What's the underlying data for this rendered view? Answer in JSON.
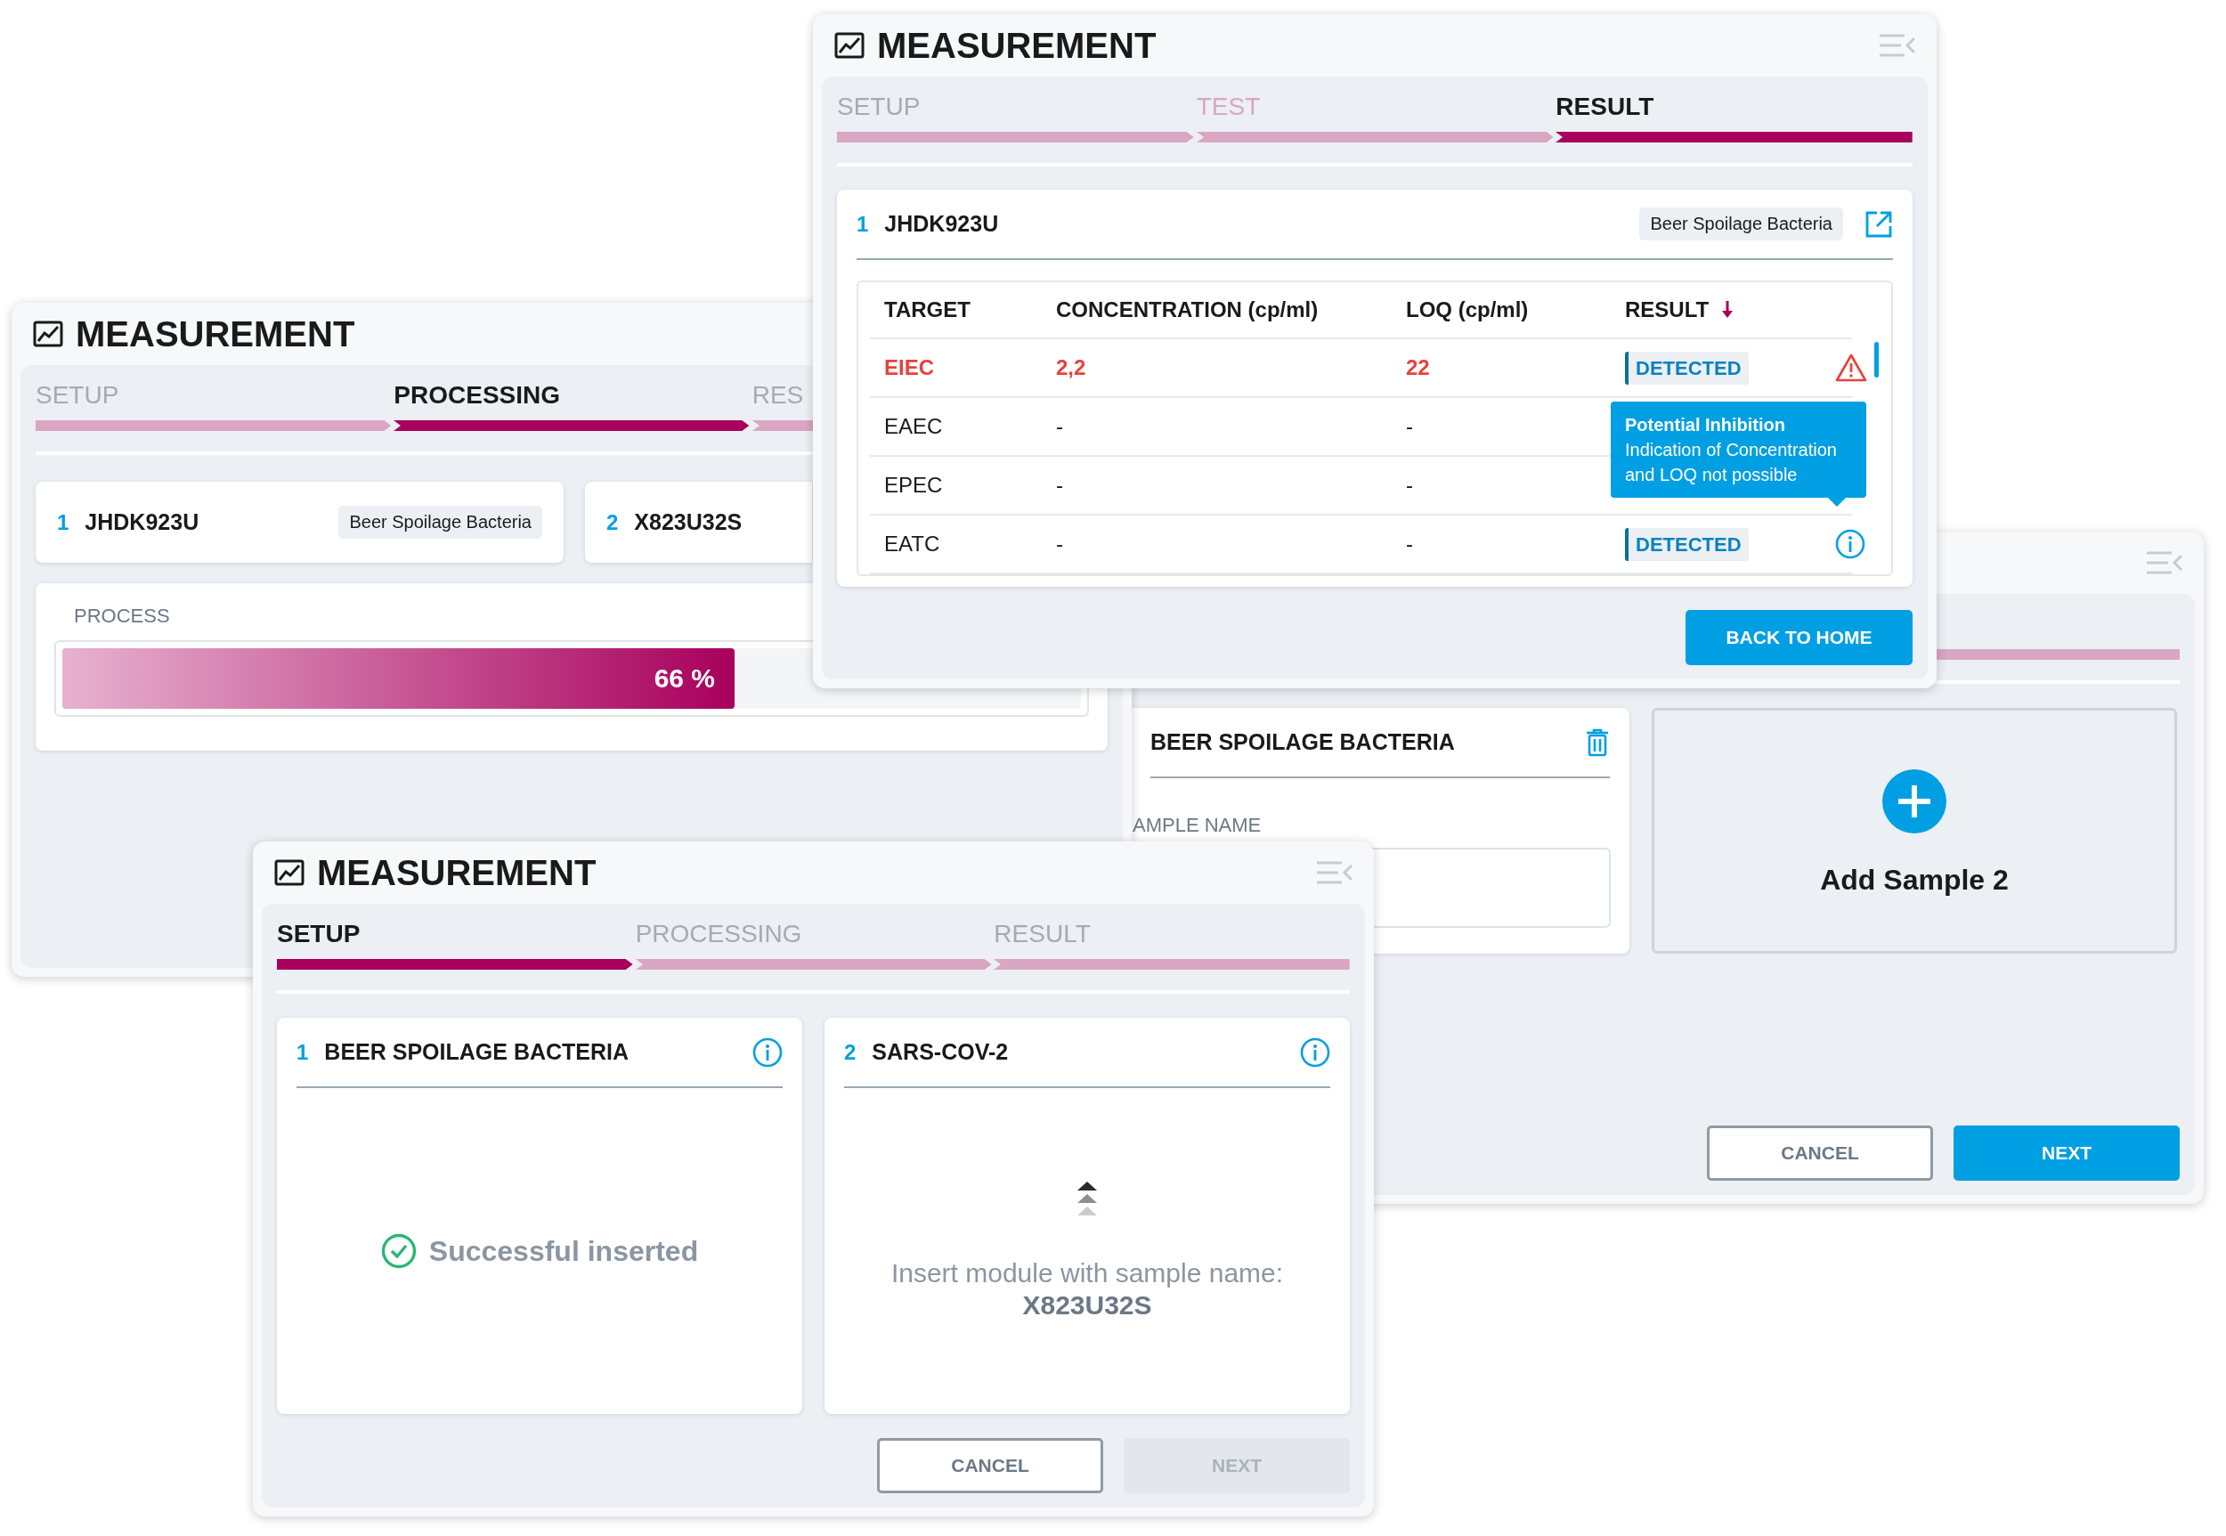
{
  "processing_window": {
    "title": "MEASUREMENT",
    "steps": [
      {
        "label": "SETUP",
        "selected": false,
        "tinted": false
      },
      {
        "label": "PROCESSING",
        "selected": true,
        "tinted": false
      },
      {
        "label": "RES",
        "selected": false,
        "tinted": false
      }
    ],
    "samples": [
      {
        "number": "1",
        "name": "JHDK923U",
        "tag": "Beer Spoilage Bacteria"
      },
      {
        "number": "2",
        "name": "X823U32S"
      }
    ],
    "process": {
      "label": "PROCESS",
      "level": 0.66,
      "reading": "66 %"
    }
  },
  "setup_window_back": {
    "sample_card": {
      "title": "BEER SPOILAGE BACTERIA",
      "field_label": "AMPLE NAME"
    },
    "add_card": {
      "label": "Add Sample 2"
    },
    "buttons": [
      {
        "label": "CANCEL",
        "kind": "secondary"
      },
      {
        "label": "NEXT",
        "kind": "primary",
        "disabled": false
      }
    ]
  },
  "result_window": {
    "title": "MEASUREMENT",
    "steps": [
      {
        "label": "SETUP",
        "selected": false,
        "tinted": false
      },
      {
        "label": "TEST",
        "selected": false,
        "tinted": true
      },
      {
        "label": "RESULT",
        "selected": true,
        "tinted": false
      }
    ],
    "sample": {
      "number": "1",
      "name": "JHDK923U",
      "tag": "Beer Spoilage Bacteria"
    },
    "table": {
      "columns": [
        {
          "label": "TARGET",
          "sorted": false
        },
        {
          "label": "CONCENTRATION (cp/ml)",
          "sorted": false
        },
        {
          "label": "LOQ (cp/ml)",
          "sorted": false
        },
        {
          "label": "RESULT",
          "sorted": true
        }
      ],
      "rows": [
        {
          "target": "EIEC",
          "concentration": "2,2",
          "loq": "22",
          "result": "DETECTED",
          "alert": true,
          "kind": "warning"
        },
        {
          "target": "EAEC",
          "concentration": "-",
          "loq": "-",
          "alert": false,
          "kind": "plain"
        },
        {
          "target": "EPEC",
          "concentration": "-",
          "loq": "-",
          "alert": false,
          "kind": "plain"
        },
        {
          "target": "EATC",
          "concentration": "-",
          "loq": "-",
          "result": "DETECTED",
          "alert": false,
          "kind": "info"
        }
      ]
    },
    "tooltip": {
      "title": "Potential Inhibition",
      "text": "Indication of Concentration and LOQ not possible"
    },
    "button": "BACK TO HOME"
  },
  "setup_window": {
    "title": "MEASUREMENT",
    "steps": [
      {
        "label": "SETUP",
        "selected": true,
        "tinted": false
      },
      {
        "label": "PROCESSING",
        "selected": false,
        "tinted": false
      },
      {
        "label": "RESULT",
        "selected": false,
        "tinted": false
      }
    ],
    "cards": [
      {
        "number": "1",
        "title": "BEER SPOILAGE BACTERIA",
        "kind": "inserted",
        "message": "Successful inserted"
      },
      {
        "number": "2",
        "title": "SARS-COV-2",
        "kind": "waiting",
        "message": "Insert module with sample name:",
        "sample_name": "X823U32S"
      }
    ],
    "buttons": [
      {
        "label": "CANCEL",
        "kind": "secondary"
      },
      {
        "label": "NEXT",
        "kind": "primary",
        "disabled": true
      }
    ]
  }
}
